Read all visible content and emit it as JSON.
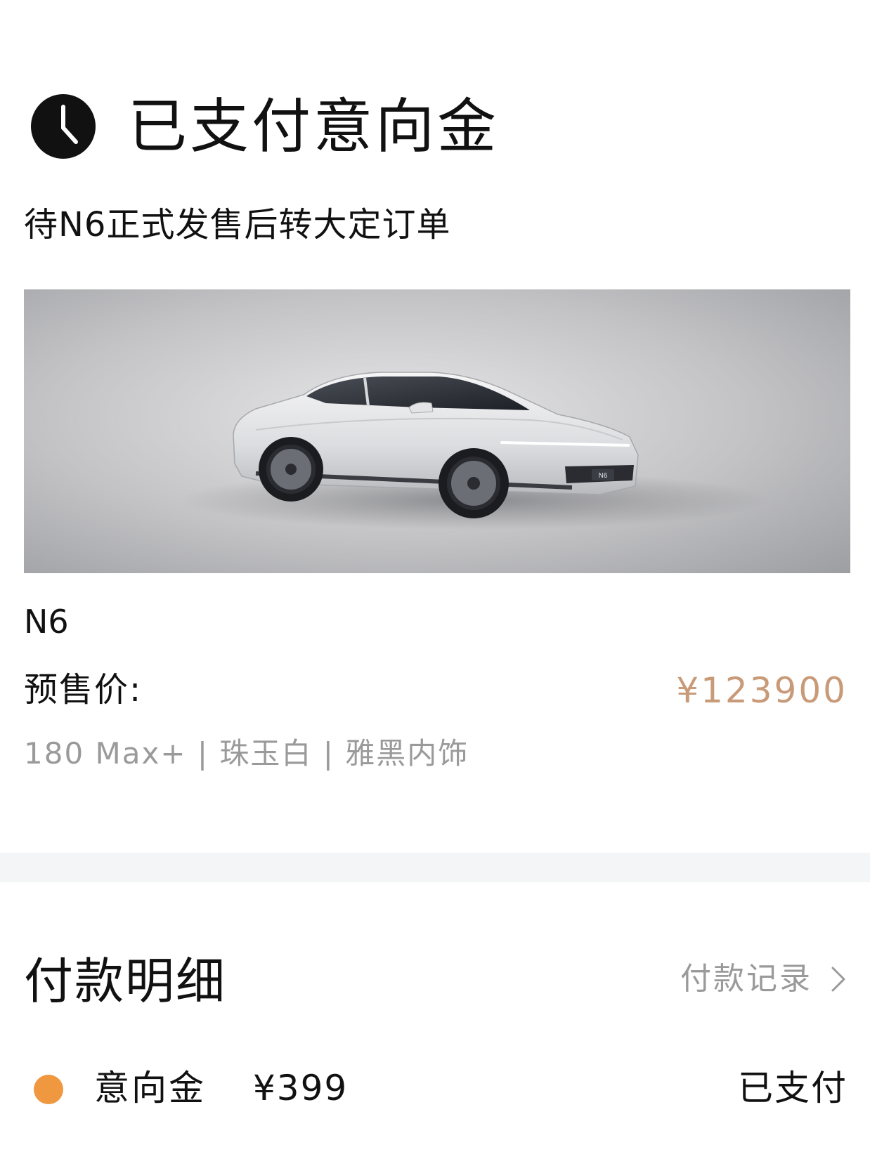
{
  "order_status": {
    "title": "已支付意向金",
    "subtitle": "待N6正式发售后转大定订单",
    "icon": "clock-icon"
  },
  "vehicle": {
    "image_alt": "N6",
    "model": "N6",
    "presale_label": "预售价:",
    "presale_price": "¥123900",
    "configuration": "180 Max+ | 珠玉白 | 雅黑内饰",
    "badge_text": "N6",
    "body_color": "#e9eaec"
  },
  "payment": {
    "section_title": "付款明细",
    "history_link": "付款记录",
    "items": [
      {
        "label": "意向金",
        "amount": "¥399",
        "status": "已支付",
        "dot_color": "#ef9840"
      }
    ]
  },
  "colors": {
    "accent_price": "#c89a78",
    "muted_text": "#9a9a9a",
    "divider": "#f4f5f7"
  }
}
